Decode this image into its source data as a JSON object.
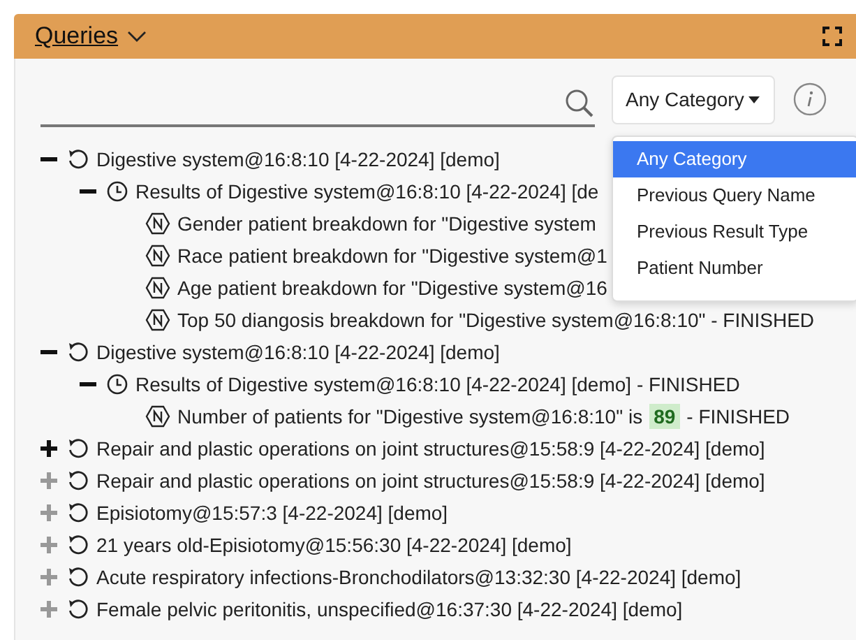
{
  "panel": {
    "title": "Queries"
  },
  "category_select": {
    "value": "Any Category",
    "options": [
      {
        "label": "Any Category",
        "selected": true
      },
      {
        "label": "Previous Query Name",
        "selected": false
      },
      {
        "label": "Previous Result Type",
        "selected": false
      },
      {
        "label": "Patient Number",
        "selected": false
      }
    ]
  },
  "tree": [
    {
      "kind": "query",
      "label": "Digestive system@16:8:10 [4-22-2024] [demo]",
      "expanded": true,
      "children": [
        {
          "kind": "result",
          "label": "Results of Digestive system@16:8:10 [4-22-2024] [de",
          "expanded": true,
          "children": [
            {
              "kind": "instance",
              "label": "Gender patient breakdown for \"Digestive system"
            },
            {
              "kind": "instance",
              "label": "Race patient breakdown for \"Digestive system@1"
            },
            {
              "kind": "instance",
              "label": "Age patient breakdown for \"Digestive system@16"
            },
            {
              "kind": "instance",
              "label": "Top 50 diangosis breakdown for \"Digestive system@16:8:10\" - FINISHED"
            }
          ]
        }
      ]
    },
    {
      "kind": "query",
      "label": "Digestive system@16:8:10 [4-22-2024] [demo]",
      "expanded": true,
      "children": [
        {
          "kind": "result",
          "label": "Results of Digestive system@16:8:10 [4-22-2024] [demo] - FINISHED",
          "expanded": true,
          "children": [
            {
              "kind": "instance",
              "label": "Number of patients for \"Digestive system@16:8:10\" is",
              "count": "89",
              "suffix": "- FINISHED"
            }
          ]
        }
      ]
    },
    {
      "kind": "query",
      "label": "Repair and plastic operations on joint structures@15:58:9 [4-22-2024] [demo]",
      "expanded": false,
      "hovered": true
    },
    {
      "kind": "query",
      "label": "Repair and plastic operations on joint structures@15:58:9 [4-22-2024] [demo]",
      "expanded": false,
      "hovered": false
    },
    {
      "kind": "query",
      "label": "Episiotomy@15:57:3 [4-22-2024] [demo]",
      "expanded": false,
      "hovered": false
    },
    {
      "kind": "query",
      "label": "21 years old-Episiotomy@15:56:30 [4-22-2024] [demo]",
      "expanded": false,
      "hovered": false
    },
    {
      "kind": "query",
      "label": "Acute respiratory infections-Bronchodilators@13:32:30 [4-22-2024] [demo]",
      "expanded": false,
      "hovered": false
    },
    {
      "kind": "query",
      "label": "Female pelvic peritonitis, unspecified@16:37:30 [4-22-2024] [demo]",
      "expanded": false,
      "hovered": false
    }
  ]
}
